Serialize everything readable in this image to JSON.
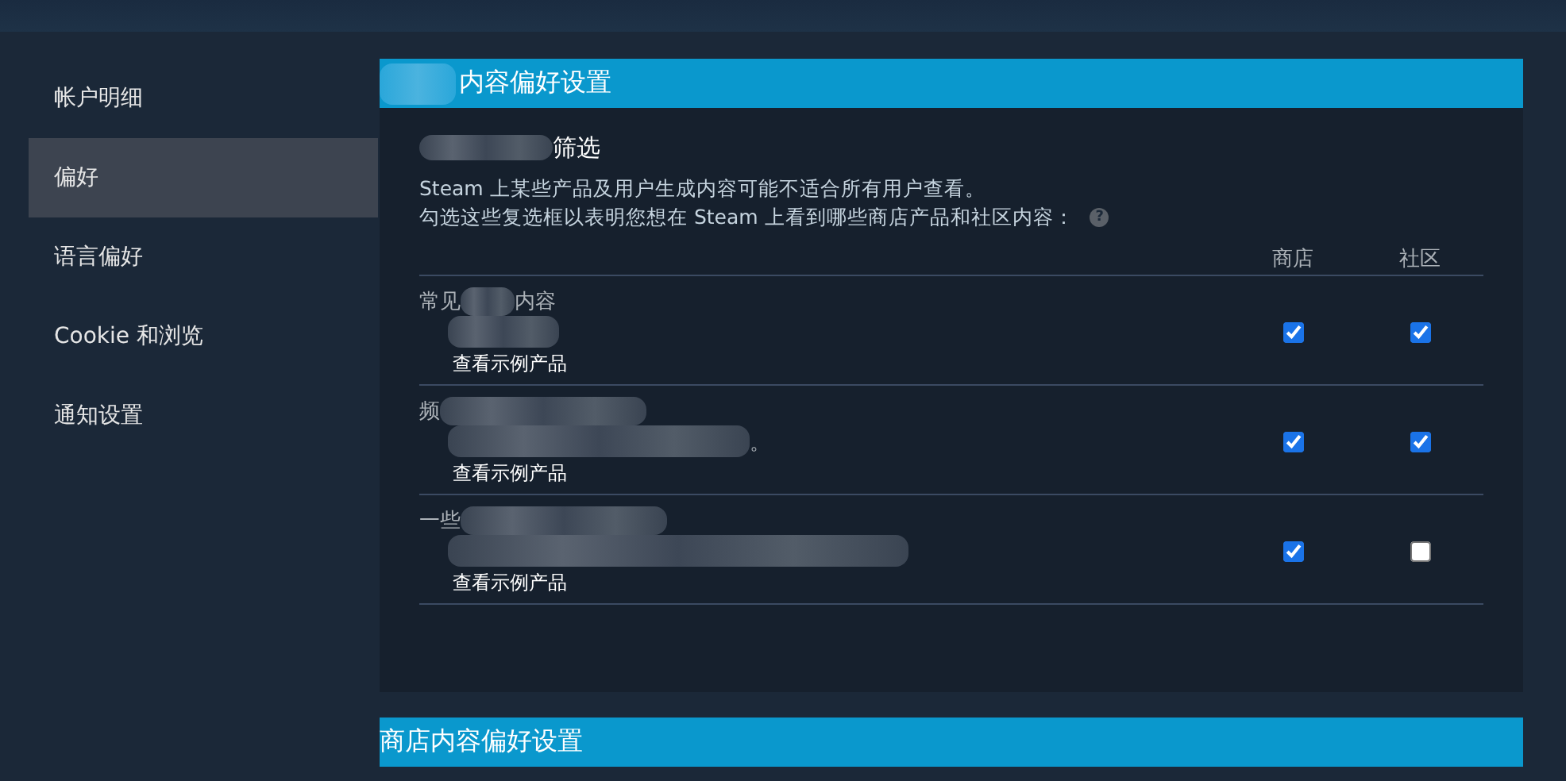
{
  "sidebar": {
    "items": [
      {
        "label": "帐户明细",
        "selected": false
      },
      {
        "label": "偏好",
        "selected": true
      },
      {
        "label": "语言偏好",
        "selected": false
      },
      {
        "label": "Cookie 和浏览",
        "selected": false
      },
      {
        "label": "通知设置",
        "selected": false
      }
    ]
  },
  "section": {
    "title_parts": [
      {
        "kind": "blur"
      },
      {
        "kind": "text",
        "text": "内容偏好设置"
      }
    ],
    "subtitle_parts": [
      {
        "kind": "blur"
      },
      {
        "kind": "text",
        "text": "筛选"
      }
    ],
    "description": [
      "Steam 上某些产品及用户生成内容可能不适合所有用户查看。",
      "勾选这些复选框以表明您想在 Steam 上看到哪些商店产品和社区内容："
    ],
    "help": "?",
    "columns": [
      "商店",
      "社区"
    ],
    "rows": [
      {
        "label_parts": [
          {
            "kind": "text",
            "text": "常见"
          },
          {
            "kind": "blur"
          },
          {
            "kind": "text",
            "text": "内容"
          }
        ],
        "desc_parts": [
          {
            "kind": "blur"
          }
        ],
        "link": "查看示例产品",
        "store": true,
        "community": true
      },
      {
        "label_parts": [
          {
            "kind": "text",
            "text": "频"
          },
          {
            "kind": "blur"
          }
        ],
        "desc_parts": [
          {
            "kind": "blur"
          },
          {
            "kind": "text",
            "text": "。"
          }
        ],
        "link": "查看示例产品",
        "store": true,
        "community": true
      },
      {
        "label_parts": [
          {
            "kind": "text",
            "text": "一些"
          },
          {
            "kind": "blur"
          }
        ],
        "desc_parts": [
          {
            "kind": "blur"
          }
        ],
        "link": "查看示例产品",
        "store": true,
        "community": false
      }
    ]
  },
  "next_section": {
    "title": "商店内容偏好设置"
  }
}
